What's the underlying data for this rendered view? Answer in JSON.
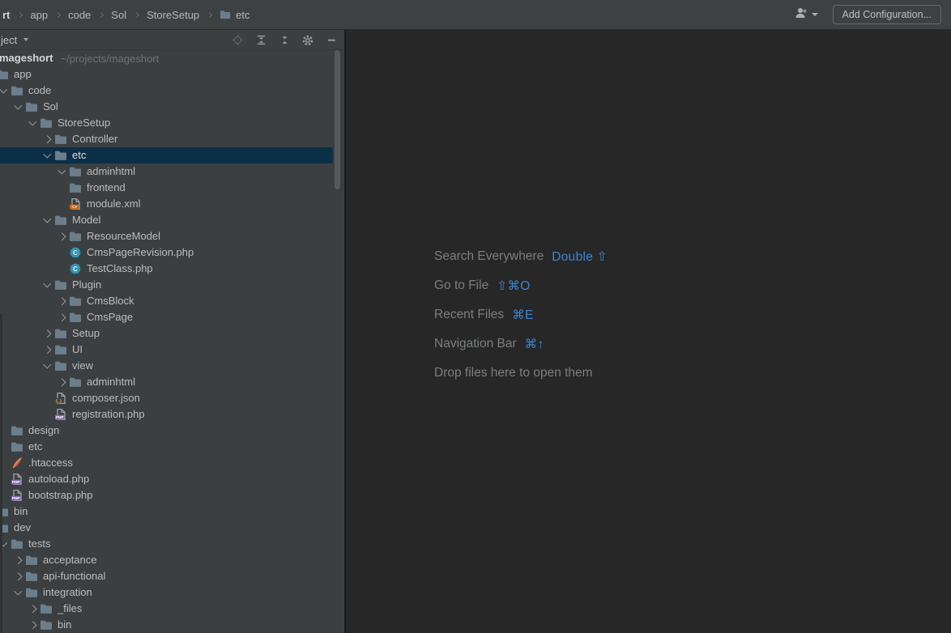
{
  "topbar": {
    "breadcrumbs": [
      {
        "label": "rt",
        "bold": true
      },
      {
        "label": "app"
      },
      {
        "label": "code"
      },
      {
        "label": "Sol"
      },
      {
        "label": "StoreSetup"
      },
      {
        "label": "etc",
        "icon": "folder"
      }
    ],
    "add_configuration_label": "Add Configuration..."
  },
  "project_panel": {
    "header": {
      "title": "ject",
      "icons": [
        "locate-file",
        "expand-all",
        "collapse-all",
        "settings-gear",
        "hide-panel"
      ]
    },
    "tree": {
      "items": [
        {
          "label": "mageshort",
          "path": "~/projects/mageshort",
          "level": 0,
          "arrow": null,
          "icon": "folder",
          "bold": true,
          "selected": false
        },
        {
          "label": "app",
          "level": 1,
          "arrow": "down",
          "icon": "folder",
          "selected": false
        },
        {
          "label": "code",
          "level": 2,
          "arrow": "down",
          "icon": "folder",
          "selected": false
        },
        {
          "label": "Sol",
          "level": 3,
          "arrow": "down",
          "icon": "folder",
          "selected": false
        },
        {
          "label": "StoreSetup",
          "level": 4,
          "arrow": "down",
          "icon": "folder",
          "selected": false
        },
        {
          "label": "Controller",
          "level": 5,
          "arrow": "right",
          "icon": "folder",
          "selected": false
        },
        {
          "label": "etc",
          "level": 5,
          "arrow": "down",
          "icon": "folder",
          "selected": true
        },
        {
          "label": "adminhtml",
          "level": 6,
          "arrow": "down",
          "icon": "folder",
          "selected": false
        },
        {
          "label": "frontend",
          "level": 6,
          "arrow": null,
          "icon": "folder",
          "selected": false
        },
        {
          "label": "module.xml",
          "level": 6,
          "arrow": null,
          "icon": "xml",
          "selected": false
        },
        {
          "label": "Model",
          "level": 5,
          "arrow": "down",
          "icon": "folder",
          "selected": false
        },
        {
          "label": "ResourceModel",
          "level": 6,
          "arrow": "right",
          "icon": "folder",
          "selected": false
        },
        {
          "label": "CmsPageRevision.php",
          "level": 6,
          "arrow": null,
          "icon": "class",
          "selected": false
        },
        {
          "label": "TestClass.php",
          "level": 6,
          "arrow": null,
          "icon": "class",
          "selected": false
        },
        {
          "label": "Plugin",
          "level": 5,
          "arrow": "down",
          "icon": "folder",
          "selected": false
        },
        {
          "label": "CmsBlock",
          "level": 6,
          "arrow": "right",
          "icon": "folder",
          "selected": false
        },
        {
          "label": "CmsPage",
          "level": 6,
          "arrow": "right",
          "icon": "folder",
          "selected": false
        },
        {
          "label": "Setup",
          "level": 5,
          "arrow": "right",
          "icon": "folder",
          "selected": false
        },
        {
          "label": "UI",
          "level": 5,
          "arrow": "right",
          "icon": "folder",
          "selected": false
        },
        {
          "label": "view",
          "level": 5,
          "arrow": "down",
          "icon": "folder",
          "selected": false
        },
        {
          "label": "adminhtml",
          "level": 6,
          "arrow": "right",
          "icon": "folder",
          "selected": false
        },
        {
          "label": "composer.json",
          "level": 5,
          "arrow": null,
          "icon": "json",
          "selected": false
        },
        {
          "label": "registration.php",
          "level": 5,
          "arrow": null,
          "icon": "php",
          "selected": false
        },
        {
          "label": "design",
          "level": 2,
          "arrow": null,
          "icon": "folder",
          "selected": false
        },
        {
          "label": "etc",
          "level": 2,
          "arrow": null,
          "icon": "folder",
          "selected": false
        },
        {
          "label": ".htaccess",
          "level": 2,
          "arrow": null,
          "icon": "htaccess",
          "selected": false
        },
        {
          "label": "autoload.php",
          "level": 2,
          "arrow": null,
          "icon": "php",
          "selected": false
        },
        {
          "label": "bootstrap.php",
          "level": 2,
          "arrow": null,
          "icon": "php",
          "selected": false
        },
        {
          "label": "bin",
          "level": 1,
          "arrow": null,
          "icon": "folder",
          "selected": false
        },
        {
          "label": "dev",
          "level": 1,
          "arrow": "down",
          "icon": "folder",
          "selected": false
        },
        {
          "label": "tests",
          "level": 2,
          "arrow": "down",
          "icon": "folder",
          "selected": false
        },
        {
          "label": "acceptance",
          "level": 3,
          "arrow": "right",
          "icon": "folder",
          "selected": false
        },
        {
          "label": "api-functional",
          "level": 3,
          "arrow": "right",
          "icon": "folder",
          "selected": false
        },
        {
          "label": "integration",
          "level": 3,
          "arrow": "down",
          "icon": "folder",
          "selected": false
        },
        {
          "label": "_files",
          "level": 4,
          "arrow": "right",
          "icon": "folder",
          "selected": false
        },
        {
          "label": "bin",
          "level": 4,
          "arrow": "right",
          "icon": "folder",
          "selected": false
        }
      ]
    }
  },
  "editor": {
    "shortcuts": [
      {
        "label": "Search Everywhere",
        "keys": "Double ⇧"
      },
      {
        "label": "Go to File",
        "keys": "⇧⌘O"
      },
      {
        "label": "Recent Files",
        "keys": "⌘E"
      },
      {
        "label": "Navigation Bar",
        "keys": "⌘↑"
      },
      {
        "label": "Drop files here to open them",
        "keys": ""
      }
    ]
  },
  "colors": {
    "topbar_bg": "#3E4142",
    "panel_bg": "#3C3F41",
    "editor_bg": "#272727",
    "selection": "#0B2F47",
    "accent_blue": "#3E84D4",
    "folder": "#6C7E8C",
    "php_badge": "#8A6BB8",
    "xml_badge": "#C4661C",
    "class_badge": "#2F93B4"
  }
}
